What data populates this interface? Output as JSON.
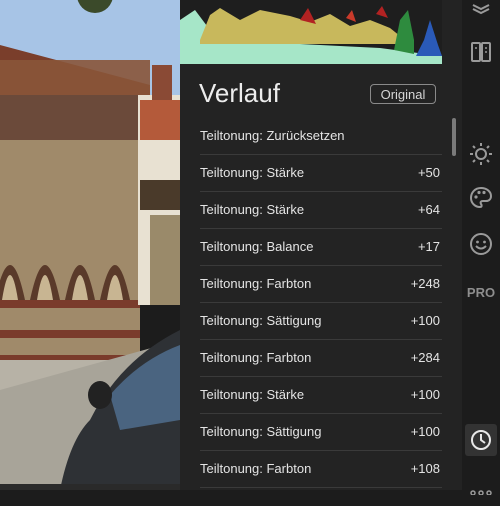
{
  "panel": {
    "title": "Verlauf",
    "original_button": "Original"
  },
  "history": [
    {
      "label": "Teiltonung: Zurücksetzen",
      "value": ""
    },
    {
      "label": "Teiltonung: Stärke",
      "value": "+50"
    },
    {
      "label": "Teiltonung: Stärke",
      "value": "+64"
    },
    {
      "label": "Teiltonung: Balance",
      "value": "+17"
    },
    {
      "label": "Teiltonung: Farbton",
      "value": "+248"
    },
    {
      "label": "Teiltonung: Sättigung",
      "value": "+100"
    },
    {
      "label": "Teiltonung: Farbton",
      "value": "+284"
    },
    {
      "label": "Teiltonung: Stärke",
      "value": "+100"
    },
    {
      "label": "Teiltonung: Sättigung",
      "value": "+100"
    },
    {
      "label": "Teiltonung: Farbton",
      "value": "+108"
    }
  ],
  "toolbar": {
    "pro_label": "PRO",
    "icons": [
      "layers-icon",
      "compare-icon",
      "sun-icon",
      "palette-icon",
      "face-icon",
      "pro-badge",
      "history-icon",
      "more-icon"
    ],
    "active": "history-icon"
  },
  "colors": {
    "panel_bg": "#232323",
    "toolbar_bg": "#1c1c1c",
    "text": "#e4e4e4",
    "divider": "#3a3a3a"
  }
}
